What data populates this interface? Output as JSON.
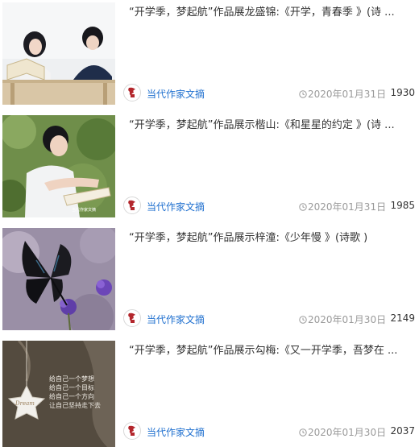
{
  "feed": {
    "items": [
      {
        "title": "“开学季，梦起航”作品展龙盛锦:《开学，青春季 》(诗 ...",
        "author": "当代作家文摘",
        "date": "2020年01月31日",
        "views": "1930",
        "thumb_icon": "students-reading-photo"
      },
      {
        "title": "“开学季，梦起航”作品展示楷山:《和星星的约定 》(诗 ...",
        "author": "当代作家文摘",
        "date": "2020年01月31日",
        "views": "1985",
        "thumb_icon": "boy-with-book-photo",
        "watermark": "当代作家文摘"
      },
      {
        "title": "“开学季，梦起航”作品展示梓潼:《少年慢 》(诗歌 )",
        "author": "当代作家文摘",
        "date": "2020年01月30日",
        "views": "2149",
        "thumb_icon": "butterfly-photo"
      },
      {
        "title": "“开学季，梦起航”作品展示勾梅:《又一开学季，吾梦在 ...",
        "author": "当代作家文摘",
        "date": "2020年01月30日",
        "views": "2037",
        "thumb_icon": "star-ornament-photo",
        "star_word": "Dream",
        "poem": [
          "给自己一个梦想",
          "给自己一个目标",
          "给自己一个方向",
          "让自己坚持走下去"
        ]
      }
    ]
  },
  "colors": {
    "author_link": "#1e6fcf",
    "meta_gray": "#9a9a9a",
    "title_text": "#333333",
    "avatar_red": "#b3262c"
  }
}
